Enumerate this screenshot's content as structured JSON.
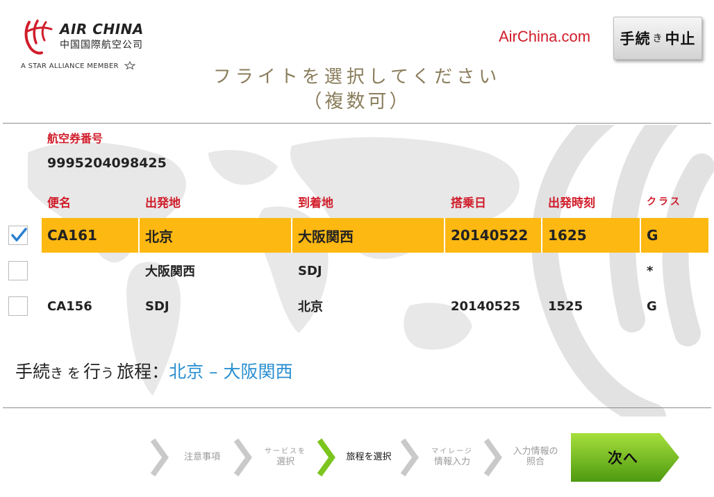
{
  "header": {
    "brand_name": "AIR CHINA",
    "brand_name_cn": "中国国際航空公司",
    "alliance_text": "A STAR ALLIANCE MEMBER",
    "site_link": "AirChina.com",
    "abort_button": {
      "main": "手続",
      "small": "き",
      "tail": "中止"
    }
  },
  "title": {
    "line1": "フライトを選択してください",
    "line2": "（複数可）"
  },
  "ticket": {
    "label": "航空券番号",
    "value": "9995204098425"
  },
  "columns": [
    "便名",
    "出発地",
    "到着地",
    "搭乗日",
    "出発時刻",
    "クラス"
  ],
  "flights": [
    {
      "checked": true,
      "flight": "CA161",
      "origin": "北京",
      "destination": "大阪関西",
      "date": "20140522",
      "time": "1625",
      "class": "G"
    },
    {
      "checked": false,
      "flight": "",
      "origin": "大阪関西",
      "destination": "SDJ",
      "date": "",
      "time": "",
      "class": "*"
    },
    {
      "checked": false,
      "flight": "CA156",
      "origin": "SDJ",
      "destination": "北京",
      "date": "20140525",
      "time": "1525",
      "class": "G"
    }
  ],
  "route": {
    "label_a": "手続",
    "label_b": "き",
    "label_c": "を",
    "label_d": "行",
    "label_e": "う",
    "label_f": "旅程：",
    "value": "北京 – 大阪関西"
  },
  "steps": [
    {
      "line1": "注意事項",
      "line2": "",
      "active": false
    },
    {
      "line1": "サービスを",
      "line2": "選択",
      "active": false
    },
    {
      "line1": "旅程を選択",
      "line2": "",
      "active": true
    },
    {
      "line1": "マイレージ",
      "line2": "情報入力",
      "active": false
    },
    {
      "line1": "入力情報の",
      "line2": "照合",
      "active": false
    }
  ],
  "next_button": "次へ",
  "colors": {
    "brand_red": "#d01c2a",
    "selected_row": "#fdb812",
    "title_gold": "#8a7d5c",
    "route_blue": "#2a8fd0",
    "next_green": "#6cbf1a"
  }
}
